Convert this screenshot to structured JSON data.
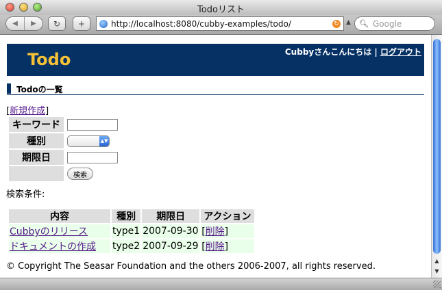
{
  "window": {
    "title": "Todoリスト"
  },
  "toolbar": {
    "back": "◀",
    "forward": "▶",
    "reload": "↻",
    "add": "+",
    "url": "http://localhost:8080/cubby-examples/todo/",
    "search_placeholder": "Google"
  },
  "header": {
    "logo": "Todo",
    "greeting": "Cubbyさんこんにちは",
    "separator": " | ",
    "logout": "ログアウト"
  },
  "section": {
    "title": "Todoの一覧"
  },
  "new_link": {
    "open": "[",
    "label": "新規作成",
    "close": "]"
  },
  "search_form": {
    "keyword_label": "キーワード",
    "keyword_value": "",
    "type_label": "種別",
    "type_value": "",
    "date_label": "期限日",
    "date_value": "",
    "submit_label": "検索"
  },
  "conditions_label": "検索条件:",
  "table": {
    "headers": [
      "内容",
      "種別",
      "期限日",
      "アクション"
    ],
    "rows": [
      {
        "text": "Cubbyのリリース",
        "type": "type1",
        "date": "2007-09-30",
        "action_open": "[",
        "action": "削除",
        "action_close": "]"
      },
      {
        "text": "ドキュメントの作成",
        "type": "type2",
        "date": "2007-09-29",
        "action_open": "[",
        "action": "削除",
        "action_close": "]"
      }
    ]
  },
  "footer": {
    "copyright": "© Copyright The Seasar Foundation and the others 2006-2007, all rights reserved."
  },
  "colors": {
    "header_bg": "#063164",
    "logo": "#f5c237",
    "row_bg": "#eaffea",
    "link": "#551a8b"
  }
}
